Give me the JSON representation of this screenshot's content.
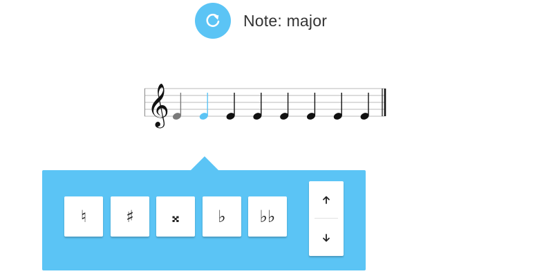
{
  "header": {
    "title": "Note: major",
    "reset_icon": "refresh-icon",
    "accent_color": "#5bc4f5"
  },
  "staff": {
    "clef": "treble-clef",
    "note_count": 8,
    "notes": [
      {
        "state": "past",
        "color": "#7a7a7a"
      },
      {
        "state": "current",
        "color": "#5bc4f5"
      },
      {
        "state": "upcoming",
        "color": "#111111"
      },
      {
        "state": "upcoming",
        "color": "#111111"
      },
      {
        "state": "upcoming",
        "color": "#111111"
      },
      {
        "state": "upcoming",
        "color": "#111111"
      },
      {
        "state": "upcoming",
        "color": "#111111"
      },
      {
        "state": "upcoming",
        "color": "#111111"
      }
    ]
  },
  "accidentals": [
    {
      "name": "natural",
      "symbol": "♮"
    },
    {
      "name": "sharp",
      "symbol": "♯"
    },
    {
      "name": "double-sharp",
      "symbol": "𝄪"
    },
    {
      "name": "flat",
      "symbol": "♭"
    },
    {
      "name": "double-flat",
      "symbol": "♭♭"
    }
  ],
  "octave": {
    "up_icon": "arrow-up-icon",
    "down_icon": "arrow-down-icon"
  }
}
